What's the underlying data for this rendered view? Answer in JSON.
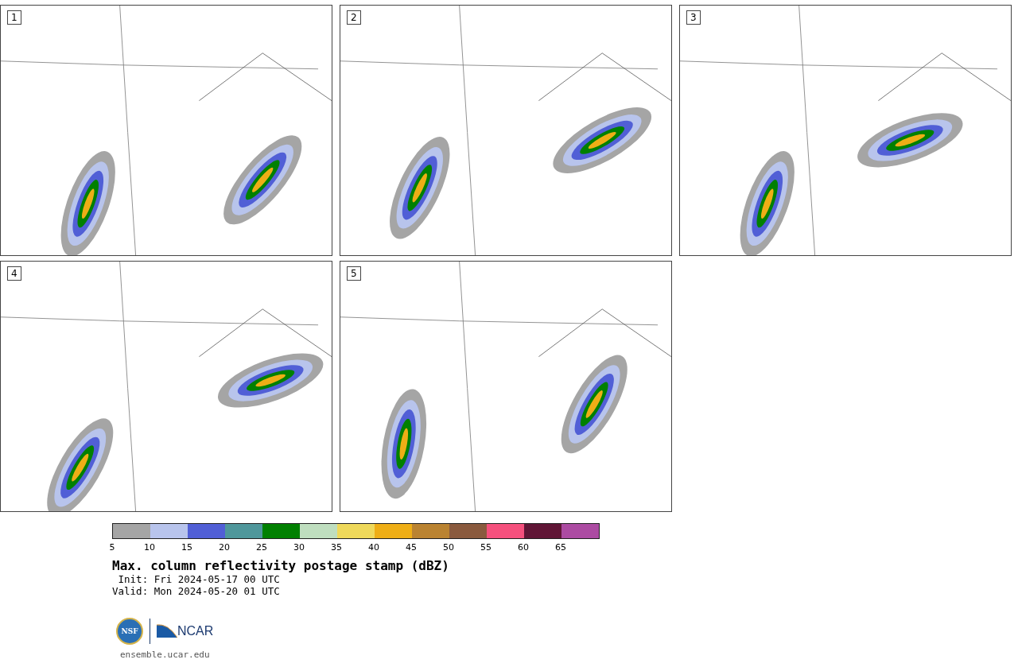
{
  "panels": [
    {
      "label": "1"
    },
    {
      "label": "2"
    },
    {
      "label": "3"
    },
    {
      "label": "4"
    },
    {
      "label": "5"
    }
  ],
  "colorbar": {
    "segments": [
      {
        "color": "#a5a5a5"
      },
      {
        "color": "#b8c4ec"
      },
      {
        "color": "#515fd6"
      },
      {
        "color": "#4f979b"
      },
      {
        "color": "#018001"
      },
      {
        "color": "#bfdebf"
      },
      {
        "color": "#efd95b"
      },
      {
        "color": "#eeae16"
      },
      {
        "color": "#ba8331"
      },
      {
        "color": "#8a5a3e"
      },
      {
        "color": "#f5507d"
      },
      {
        "color": "#601636"
      },
      {
        "color": "#ac4ba2"
      }
    ],
    "ticks": [
      "5",
      "10",
      "15",
      "20",
      "25",
      "30",
      "35",
      "40",
      "45",
      "50",
      "55",
      "60",
      "65"
    ]
  },
  "title": "Max. column reflectivity postage stamp (dBZ)",
  "init": " Init: Fri 2024-05-17 00 UTC",
  "valid": "Valid: Mon 2024-05-20 01 UTC",
  "logos": {
    "nsf": "NSF",
    "ncar": "NCAR"
  },
  "site": "ensemble.ucar.edu"
}
